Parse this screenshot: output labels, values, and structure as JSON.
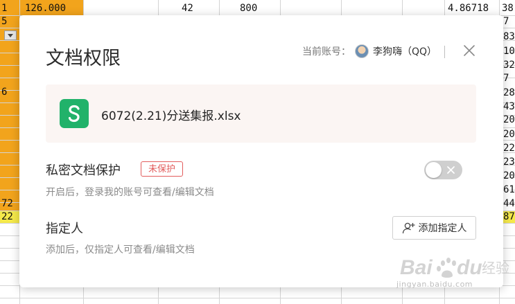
{
  "sheet": {
    "top_row": [
      "1",
      "126.000",
      "42",
      "800",
      "4.86718",
      "38"
    ],
    "left_col": [
      "5",
      "",
      "",
      "",
      "",
      "6",
      "",
      "",
      "",
      "",
      "",
      "",
      "",
      "",
      "72",
      "22"
    ],
    "right_col": [
      "7",
      "83",
      "10",
      "32",
      "7",
      "28",
      "43",
      "20",
      "20",
      "22",
      "23",
      "20",
      "61",
      "44",
      "87"
    ]
  },
  "dialog": {
    "title": "文档权限",
    "account_label": "当前账号：",
    "account_name": "李狗嗨（QQ）",
    "file_name": "6072(2.21)分送集报.xlsx",
    "privacy": {
      "title": "私密文档保护",
      "status": "未保护",
      "desc": "开启后，登录我的账号可查看/编辑文档",
      "enabled": false
    },
    "designee": {
      "title": "指定人",
      "desc": "添加后，仅指定人可查看/编辑文档",
      "button": "添加指定人"
    }
  },
  "watermark": {
    "text": "Baidu经验",
    "sub": "jingyan.baidu.com"
  }
}
